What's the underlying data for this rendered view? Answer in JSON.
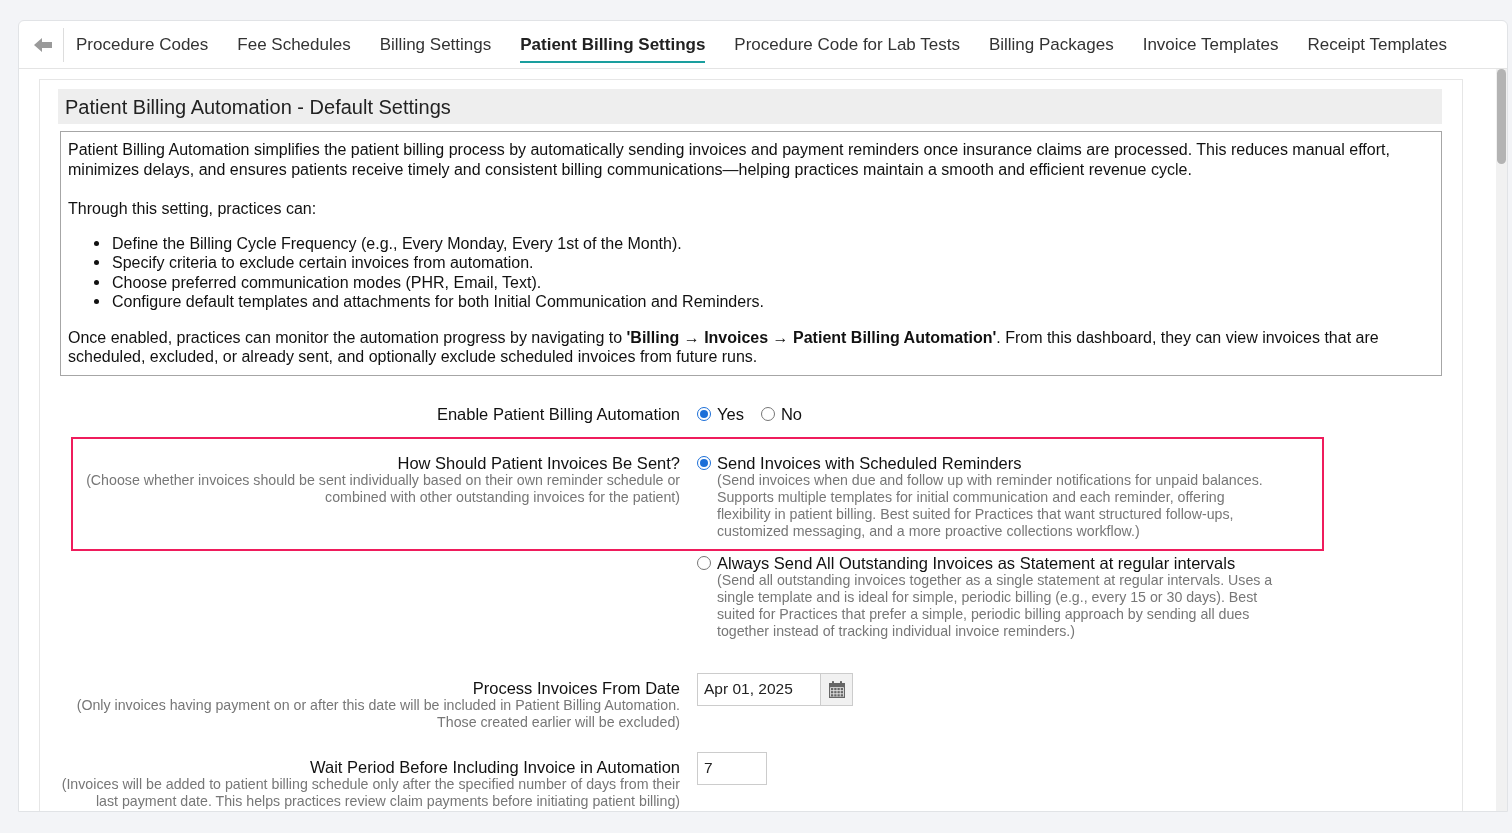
{
  "tabs": [
    {
      "label": "Procedure Codes",
      "selected": false
    },
    {
      "label": "Fee Schedules",
      "selected": false
    },
    {
      "label": "Billing Settings",
      "selected": false
    },
    {
      "label": "Patient Billing Settings",
      "selected": true
    },
    {
      "label": "Procedure Code for Lab Tests",
      "selected": false
    },
    {
      "label": "Billing Packages",
      "selected": false
    },
    {
      "label": "Invoice Templates",
      "selected": false
    },
    {
      "label": "Receipt Templates",
      "selected": false
    }
  ],
  "section": {
    "title": "Patient Billing Automation - Default Settings"
  },
  "description": {
    "intro": "Patient Billing Automation simplifies the patient billing process by automatically sending invoices and payment reminders once insurance claims are processed. This reduces manual effort, minimizes delays, and ensures patients receive timely and consistent billing communications—helping practices maintain a smooth and efficient revenue cycle.",
    "lead": "Through this setting, practices can:",
    "bullets": [
      "Define the Billing Cycle Frequency (e.g., Every Monday, Every 1st of the Month).",
      "Specify criteria to exclude certain invoices from automation.",
      "Choose preferred communication modes (PHR, Email, Text).",
      "Configure default templates and attachments for both Initial Communication and Reminders."
    ],
    "closing": "Once enabled, practices can monitor the automation progress by navigating to **'Billing → Invoices → Patient Billing Automation'**. From this dashboard, they can view invoices that are scheduled, excluded, or already sent, and optionally exclude scheduled invoices from future runs."
  },
  "settings": [
    {
      "kind": "radio_inline",
      "label": "Enable Patient Billing Automation",
      "options": [
        {
          "label": "Yes",
          "selected": true
        },
        {
          "label": "No",
          "selected": false
        }
      ]
    },
    {
      "kind": "radio_list",
      "label": "How Should Patient Invoices Be Sent?",
      "hint": "(Choose whether invoices should be sent individually based on their own reminder schedule or combined with other outstanding invoices for the patient)",
      "options": [
        {
          "label": "Send Invoices with Scheduled Reminders",
          "description": "(Send invoices when due and follow up with reminder notifications for unpaid balances. Supports multiple templates for initial communication and each reminder, offering flexibility in patient billing. Best suited for Practices that want structured follow-ups, customized messaging, and a more proactive collections workflow.)",
          "selected": true,
          "highlighted": true
        },
        {
          "label": "Always Send All Outstanding Invoices as Statement at regular intervals",
          "description": "(Send all outstanding invoices together as a single statement at regular intervals. Uses a single template and is ideal for simple, periodic billing (e.g., every 15 or 30 days). Best suited for Practices that prefer a simple, periodic billing approach by sending all dues together instead of tracking individual invoice reminders.)",
          "selected": false,
          "highlighted": false
        }
      ]
    },
    {
      "kind": "date",
      "label": "Process Invoices From Date",
      "hint": "(Only invoices having payment on or after this date will be included in Patient Billing Automation. Those created earlier will be excluded)",
      "value": "Apr 01, 2025"
    },
    {
      "kind": "number",
      "label": "Wait Period Before Including Invoice in Automation",
      "hint": "(Invoices will be added to patient billing schedule only after the specified number of days from their last payment date. This helps practices review claim payments before initiating patient billing)",
      "value": "7"
    }
  ]
}
